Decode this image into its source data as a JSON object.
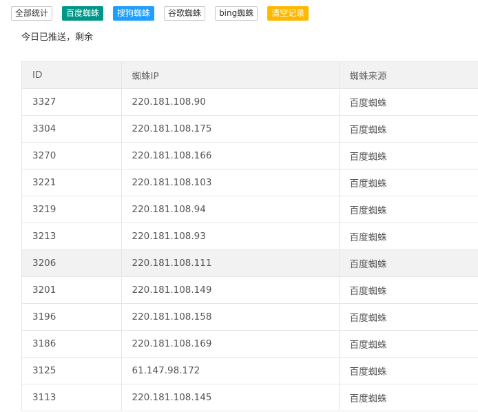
{
  "toolbar": {
    "buttons": [
      {
        "label": "全部统计"
      },
      {
        "label": "百度蜘蛛"
      },
      {
        "label": "搜狗蜘蛛"
      },
      {
        "label": "谷歌蜘蛛"
      },
      {
        "label": "bing蜘蛛"
      },
      {
        "label": "清空记录"
      }
    ]
  },
  "colors": {
    "baidu_button": "#009688",
    "sogou_button": "#1e9fff",
    "clear_button": "#ffb800",
    "table_header_bg": "#f2f2f2",
    "border": "#e6e6e6"
  },
  "notice": {
    "text": "今日已推送，剩余"
  },
  "table": {
    "headers": [
      "ID",
      "蜘蛛IP",
      "蜘蛛来源"
    ],
    "rows": [
      [
        "3327",
        "220.181.108.90",
        "百度蜘蛛"
      ],
      [
        "3304",
        "220.181.108.175",
        "百度蜘蛛"
      ],
      [
        "3270",
        "220.181.108.166",
        "百度蜘蛛"
      ],
      [
        "3221",
        "220.181.108.103",
        "百度蜘蛛"
      ],
      [
        "3219",
        "220.181.108.94",
        "百度蜘蛛"
      ],
      [
        "3213",
        "220.181.108.93",
        "百度蜘蛛"
      ],
      [
        "3206",
        "220.181.108.111",
        "百度蜘蛛"
      ],
      [
        "3201",
        "220.181.108.149",
        "百度蜘蛛"
      ],
      [
        "3196",
        "220.181.108.158",
        "百度蜘蛛"
      ],
      [
        "3186",
        "220.181.108.169",
        "百度蜘蛛"
      ],
      [
        "3125",
        "61.147.98.172",
        "百度蜘蛛"
      ],
      [
        "3113",
        "220.181.108.145",
        "百度蜘蛛"
      ]
    ]
  }
}
